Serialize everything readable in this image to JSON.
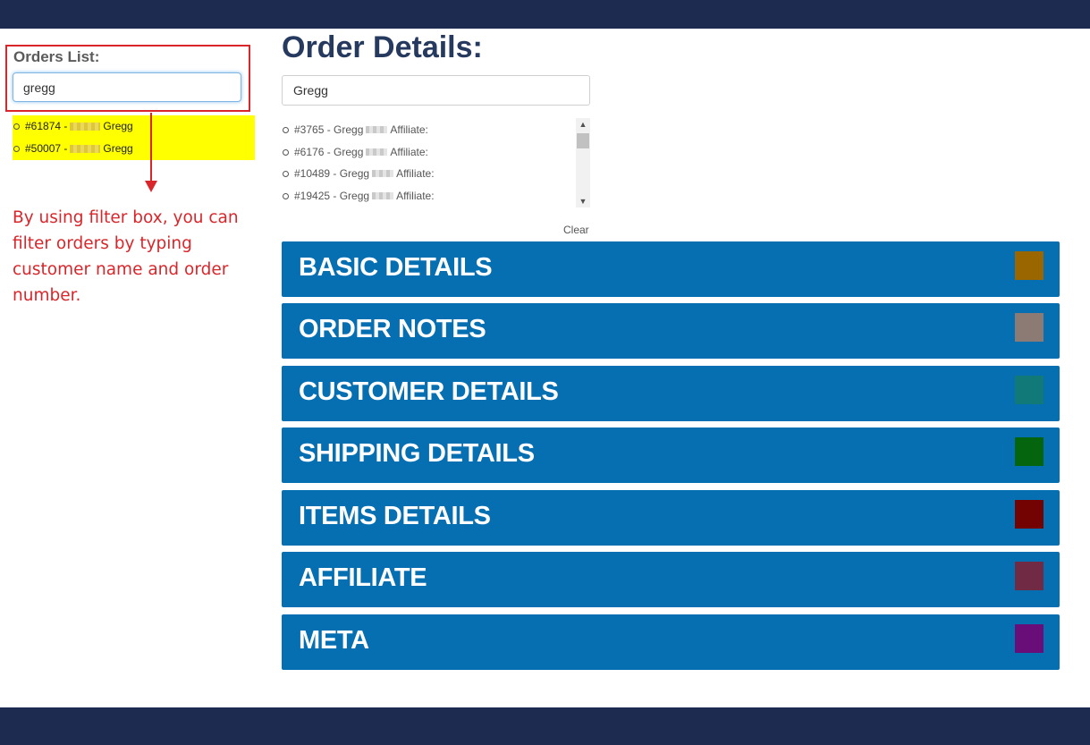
{
  "orders_panel": {
    "label": "Orders List:",
    "filter_value": "gregg",
    "results": [
      {
        "prefix": "#61874 -",
        "suffix": "Gregg"
      },
      {
        "prefix": "#50007 -",
        "suffix": "Gregg"
      }
    ]
  },
  "annotation": {
    "text": "By using filter box, you can filter orders by typing customer name and order number."
  },
  "order_details": {
    "title": "Order Details:",
    "search_value": "Gregg",
    "list": [
      {
        "prefix": "#3765 - Gregg",
        "suffix": "Affiliate:"
      },
      {
        "prefix": "#6176 - Gregg",
        "suffix": "Affiliate:"
      },
      {
        "prefix": "#10489 - Gregg",
        "suffix": "Affiliate:"
      },
      {
        "prefix": "#19425 - Gregg",
        "suffix": "Affiliate:"
      }
    ],
    "clear_label": "Clear"
  },
  "sections": [
    {
      "title": "BASIC DETAILS",
      "color": "#996600"
    },
    {
      "title": "ORDER NOTES",
      "color": "#8c7b75"
    },
    {
      "title": "CUSTOMER DETAILS",
      "color": "#117a78"
    },
    {
      "title": "SHIPPING DETAILS",
      "color": "#05650f"
    },
    {
      "title": "ITEMS DETAILS",
      "color": "#730303"
    },
    {
      "title": "AFFILIATE",
      "color": "#702a44"
    },
    {
      "title": "META",
      "color": "#690e78"
    }
  ],
  "colors": {
    "header_bar": "#1e2b50",
    "section_bg": "#066fb2",
    "highlight": "#ffff00",
    "annotation": "#d9262b"
  }
}
